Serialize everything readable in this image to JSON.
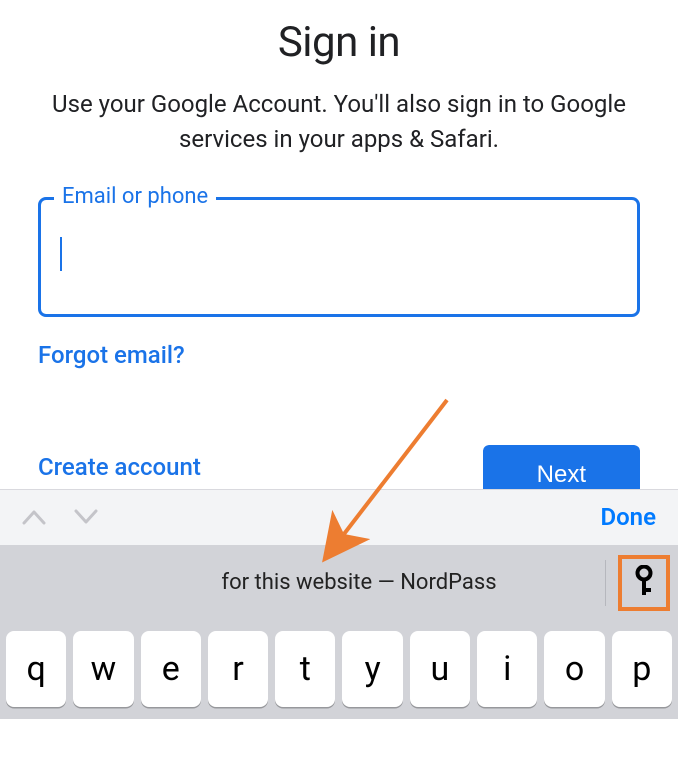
{
  "signin": {
    "title": "Sign in",
    "subtitle": "Use your Google Account. You'll also sign in to Google services in your apps & Safari.",
    "email_label": "Email or phone",
    "email_value": "",
    "forgot_link": "Forgot email?",
    "create_link": "Create account",
    "next_label": "Next"
  },
  "keyboard_bar": {
    "done_label": "Done",
    "autofill_text": "for this website — NordPass"
  },
  "keyboard": {
    "row1": [
      "q",
      "w",
      "e",
      "r",
      "t",
      "y",
      "u",
      "i",
      "o",
      "p"
    ]
  },
  "colors": {
    "primary_blue": "#1a73e8",
    "ios_blue": "#007aff",
    "annotation_orange": "#ed7d31",
    "kb_gray": "#d2d3d8"
  }
}
